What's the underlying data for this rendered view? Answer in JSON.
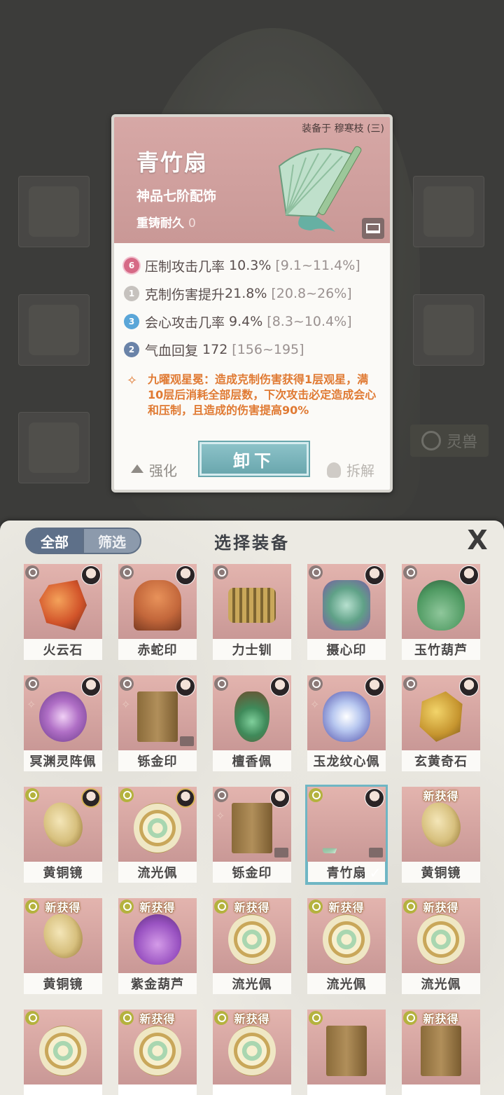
{
  "detail": {
    "equipped_on": "装备于 穆寒枝 (三)",
    "name": "青竹扇",
    "grade": "神品七阶配饰",
    "recast_label": "重铸耐久",
    "recast_value": "0",
    "stats": [
      {
        "badge": "6",
        "name": "压制攻击几率",
        "value": "10.3%",
        "range": "[9.1~11.4%]"
      },
      {
        "badge": "1",
        "name": "克制伤害提升",
        "value": "21.8%",
        "range": "[20.8~26%]"
      },
      {
        "badge": "3",
        "name": "会心攻击几率",
        "value": "9.4%",
        "range": "[8.3~10.4%]"
      },
      {
        "badge": "2",
        "name": "气血回复",
        "value": "172",
        "range": "[156~195]"
      }
    ],
    "skill_text": "九曜观星冕：造成克制伤害获得1层观星，满10层后消耗全部层数，下次攻击必定造成会心和压制，且造成的伤害提高90%",
    "actions": {
      "upgrade": "强化",
      "unequip": "卸下",
      "dismantle": "拆解"
    }
  },
  "background": {
    "spirit_beast_tab": "灵兽"
  },
  "panel": {
    "title": "选择装备",
    "filter_all": "全部",
    "filter_select": "筛选",
    "close": "X",
    "new_label": "新获得",
    "check": "✓",
    "items": [
      {
        "name": "火云石"
      },
      {
        "name": "赤蛇印"
      },
      {
        "name": "力士钏"
      },
      {
        "name": "摄心印"
      },
      {
        "name": "玉竹葫芦"
      },
      {
        "name": "冥渊灵阵佩"
      },
      {
        "name": "铄金印"
      },
      {
        "name": "檀香佩"
      },
      {
        "name": "玉龙纹心佩"
      },
      {
        "name": "玄黄奇石"
      },
      {
        "name": "黄铜镜"
      },
      {
        "name": "流光佩"
      },
      {
        "name": "铄金印"
      },
      {
        "name": "青竹扇"
      },
      {
        "name": "黄铜镜"
      },
      {
        "name": "黄铜镜"
      },
      {
        "name": "紫金葫芦"
      },
      {
        "name": "流光佩"
      },
      {
        "name": "流光佩"
      },
      {
        "name": "流光佩"
      }
    ]
  },
  "colors": {
    "accent_teal": "#6fb6c4",
    "skill_orange": "#e07a33",
    "card_pink": "#c99896"
  }
}
